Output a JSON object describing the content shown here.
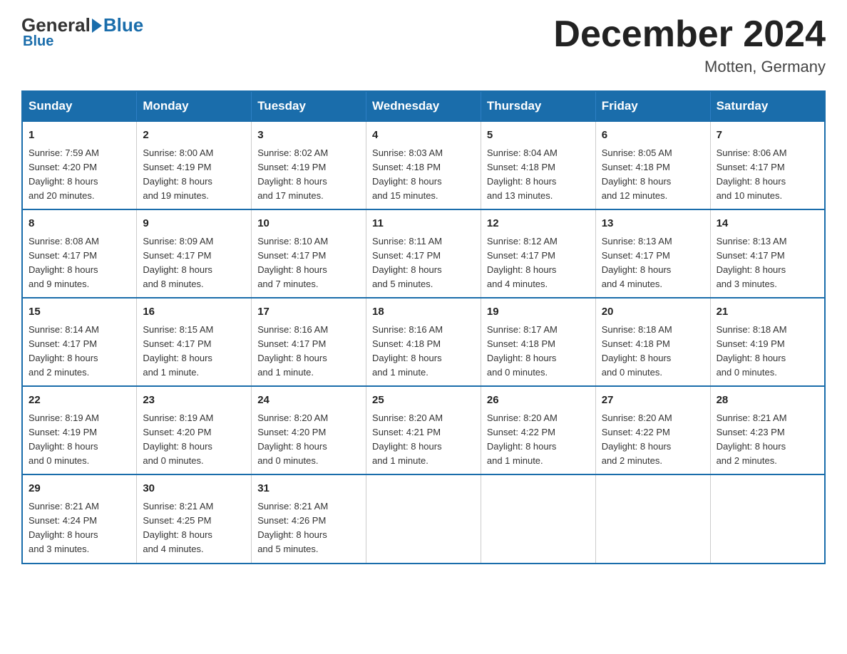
{
  "header": {
    "logo_general": "General",
    "logo_blue": "Blue",
    "month_title": "December 2024",
    "location": "Motten, Germany"
  },
  "weekdays": [
    "Sunday",
    "Monday",
    "Tuesday",
    "Wednesday",
    "Thursday",
    "Friday",
    "Saturday"
  ],
  "weeks": [
    [
      {
        "day": "1",
        "sunrise": "7:59 AM",
        "sunset": "4:20 PM",
        "daylight": "8 hours and 20 minutes."
      },
      {
        "day": "2",
        "sunrise": "8:00 AM",
        "sunset": "4:19 PM",
        "daylight": "8 hours and 19 minutes."
      },
      {
        "day": "3",
        "sunrise": "8:02 AM",
        "sunset": "4:19 PM",
        "daylight": "8 hours and 17 minutes."
      },
      {
        "day": "4",
        "sunrise": "8:03 AM",
        "sunset": "4:18 PM",
        "daylight": "8 hours and 15 minutes."
      },
      {
        "day": "5",
        "sunrise": "8:04 AM",
        "sunset": "4:18 PM",
        "daylight": "8 hours and 13 minutes."
      },
      {
        "day": "6",
        "sunrise": "8:05 AM",
        "sunset": "4:18 PM",
        "daylight": "8 hours and 12 minutes."
      },
      {
        "day": "7",
        "sunrise": "8:06 AM",
        "sunset": "4:17 PM",
        "daylight": "8 hours and 10 minutes."
      }
    ],
    [
      {
        "day": "8",
        "sunrise": "8:08 AM",
        "sunset": "4:17 PM",
        "daylight": "8 hours and 9 minutes."
      },
      {
        "day": "9",
        "sunrise": "8:09 AM",
        "sunset": "4:17 PM",
        "daylight": "8 hours and 8 minutes."
      },
      {
        "day": "10",
        "sunrise": "8:10 AM",
        "sunset": "4:17 PM",
        "daylight": "8 hours and 7 minutes."
      },
      {
        "day": "11",
        "sunrise": "8:11 AM",
        "sunset": "4:17 PM",
        "daylight": "8 hours and 5 minutes."
      },
      {
        "day": "12",
        "sunrise": "8:12 AM",
        "sunset": "4:17 PM",
        "daylight": "8 hours and 4 minutes."
      },
      {
        "day": "13",
        "sunrise": "8:13 AM",
        "sunset": "4:17 PM",
        "daylight": "8 hours and 4 minutes."
      },
      {
        "day": "14",
        "sunrise": "8:13 AM",
        "sunset": "4:17 PM",
        "daylight": "8 hours and 3 minutes."
      }
    ],
    [
      {
        "day": "15",
        "sunrise": "8:14 AM",
        "sunset": "4:17 PM",
        "daylight": "8 hours and 2 minutes."
      },
      {
        "day": "16",
        "sunrise": "8:15 AM",
        "sunset": "4:17 PM",
        "daylight": "8 hours and 1 minute."
      },
      {
        "day": "17",
        "sunrise": "8:16 AM",
        "sunset": "4:17 PM",
        "daylight": "8 hours and 1 minute."
      },
      {
        "day": "18",
        "sunrise": "8:16 AM",
        "sunset": "4:18 PM",
        "daylight": "8 hours and 1 minute."
      },
      {
        "day": "19",
        "sunrise": "8:17 AM",
        "sunset": "4:18 PM",
        "daylight": "8 hours and 0 minutes."
      },
      {
        "day": "20",
        "sunrise": "8:18 AM",
        "sunset": "4:18 PM",
        "daylight": "8 hours and 0 minutes."
      },
      {
        "day": "21",
        "sunrise": "8:18 AM",
        "sunset": "4:19 PM",
        "daylight": "8 hours and 0 minutes."
      }
    ],
    [
      {
        "day": "22",
        "sunrise": "8:19 AM",
        "sunset": "4:19 PM",
        "daylight": "8 hours and 0 minutes."
      },
      {
        "day": "23",
        "sunrise": "8:19 AM",
        "sunset": "4:20 PM",
        "daylight": "8 hours and 0 minutes."
      },
      {
        "day": "24",
        "sunrise": "8:20 AM",
        "sunset": "4:20 PM",
        "daylight": "8 hours and 0 minutes."
      },
      {
        "day": "25",
        "sunrise": "8:20 AM",
        "sunset": "4:21 PM",
        "daylight": "8 hours and 1 minute."
      },
      {
        "day": "26",
        "sunrise": "8:20 AM",
        "sunset": "4:22 PM",
        "daylight": "8 hours and 1 minute."
      },
      {
        "day": "27",
        "sunrise": "8:20 AM",
        "sunset": "4:22 PM",
        "daylight": "8 hours and 2 minutes."
      },
      {
        "day": "28",
        "sunrise": "8:21 AM",
        "sunset": "4:23 PM",
        "daylight": "8 hours and 2 minutes."
      }
    ],
    [
      {
        "day": "29",
        "sunrise": "8:21 AM",
        "sunset": "4:24 PM",
        "daylight": "8 hours and 3 minutes."
      },
      {
        "day": "30",
        "sunrise": "8:21 AM",
        "sunset": "4:25 PM",
        "daylight": "8 hours and 4 minutes."
      },
      {
        "day": "31",
        "sunrise": "8:21 AM",
        "sunset": "4:26 PM",
        "daylight": "8 hours and 5 minutes."
      },
      null,
      null,
      null,
      null
    ]
  ],
  "labels": {
    "sunrise": "Sunrise:",
    "sunset": "Sunset:",
    "daylight": "Daylight:"
  }
}
